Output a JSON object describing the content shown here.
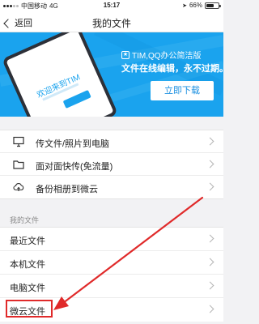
{
  "status_bar": {
    "carrier": "中国移动",
    "network": "4G",
    "time": "15:17",
    "battery": "66%",
    "battery_fraction": 0.66
  },
  "nav": {
    "back_label": "返回",
    "title": "我的文件"
  },
  "banner": {
    "phone_welcome": "欢迎来到TIM",
    "brand": "TIM,QQ办公简洁版",
    "slogan": "文件在线编辑，永不过期。",
    "download_label": "立即下载",
    "background_color": "#1aa3ee"
  },
  "quick_actions": [
    {
      "icon": "monitor-icon",
      "label": "传文件/照片到电脑"
    },
    {
      "icon": "folder-icon",
      "label": "面对面快传(免流量)"
    },
    {
      "icon": "cloud-upload-icon",
      "label": "备份相册到微云"
    }
  ],
  "files_section": {
    "title": "我的文件",
    "items": [
      {
        "label": "最近文件"
      },
      {
        "label": "本机文件"
      },
      {
        "label": "电脑文件"
      },
      {
        "label": "微云文件"
      }
    ]
  },
  "annotation": {
    "color": "#e02a2a"
  }
}
